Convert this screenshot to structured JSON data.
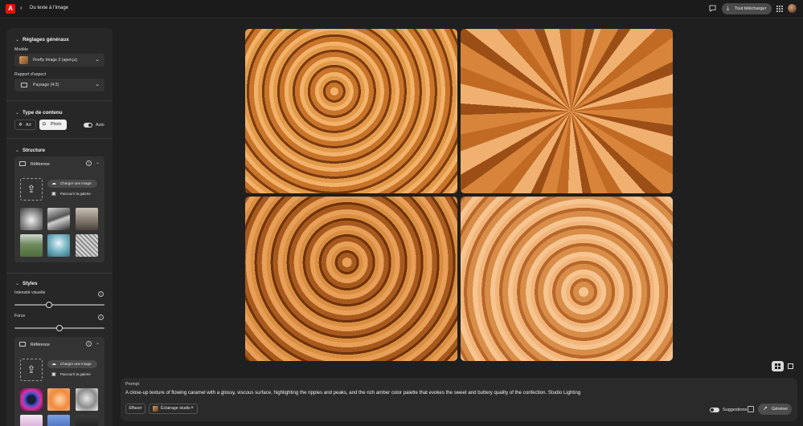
{
  "topbar": {
    "logo_text": "A",
    "back_icon": "chevron-left-icon",
    "title": "Du texte à l’image",
    "download_label": "Tout télécharger",
    "icons": [
      "comment-icon",
      "download-icon",
      "apps-grid-icon",
      "avatar"
    ]
  },
  "panel": {
    "general": {
      "title": "Réglages généraux",
      "model_label": "Modèle",
      "model_value": "Firefly Image 3 (aperçu)",
      "aspect_label": "Rapport d’aspect",
      "aspect_value": "Paysage (4:3)"
    },
    "content_type": {
      "title": "Type de contenu",
      "art_label": "Art",
      "photo_label": "Photo",
      "selected": "Photo",
      "auto_label": "Auto",
      "auto_on": true
    },
    "structure": {
      "title": "Structure",
      "reference_label": "Référence",
      "upload_label": "Charger une image",
      "browse_label": "Parcourir la galerie"
    },
    "styles": {
      "title": "Styles",
      "visual_intensity_label": "Intensité visuelle",
      "visual_intensity_value": 0.38,
      "strength_label": "Force",
      "strength_value": 0.5,
      "reference_label": "Référence",
      "upload_label": "Charger une image",
      "browse_label": "Parcourir la galerie"
    }
  },
  "view": {
    "grid_icon": "grid-view-icon",
    "single_icon": "single-view-icon",
    "active": "grid"
  },
  "prompt": {
    "label": "Prompt",
    "text": "A close-up texture of flowing caramel with a glossy, viscous surface, highlighting the ripples and peaks, and the rich amber color palette that evokes the sweet and buttery quality of the confection. Studio Lighting",
    "clear_label": "Effacer",
    "chip_label": "Éclairage studio",
    "suggestions_label": "Suggestions",
    "generate_label": "Générer"
  },
  "colors": {
    "background": "#1f1f1f",
    "panel": "#272727",
    "brand_red": "#eb1000",
    "caramel": "#c8742a"
  }
}
